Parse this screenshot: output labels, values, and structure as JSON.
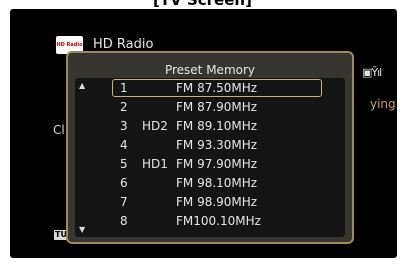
{
  "caption": "[TV Screen]",
  "header": {
    "logo_text": "HD Radio",
    "source_label": "HD Radio"
  },
  "background_partial_text": {
    "left": "Cl",
    "right": "ying",
    "tuner_badge": "TU",
    "signal": "▣Ȳıl"
  },
  "popup": {
    "title": "Preset Memory",
    "scroll_up": "▲",
    "scroll_down": "▼",
    "selected_index": 0,
    "presets": [
      {
        "num": "1",
        "band": "",
        "freq": "FM 87.50MHz"
      },
      {
        "num": "2",
        "band": "",
        "freq": "FM 87.90MHz"
      },
      {
        "num": "3",
        "band": "HD2",
        "freq": "FM 89.10MHz"
      },
      {
        "num": "4",
        "band": "",
        "freq": "FM 93.30MHz"
      },
      {
        "num": "5",
        "band": "HD1",
        "freq": "FM 97.90MHz"
      },
      {
        "num": "6",
        "band": "",
        "freq": "FM 98.10MHz"
      },
      {
        "num": "7",
        "band": "",
        "freq": "FM 98.90MHz"
      },
      {
        "num": "8",
        "band": "",
        "freq": "FM100.10MHz"
      }
    ]
  },
  "colors": {
    "screen_bg": "#000000",
    "popup_bg": "#36352f",
    "popup_border": "#9b8a5c",
    "accent_text": "#c9a25a"
  }
}
